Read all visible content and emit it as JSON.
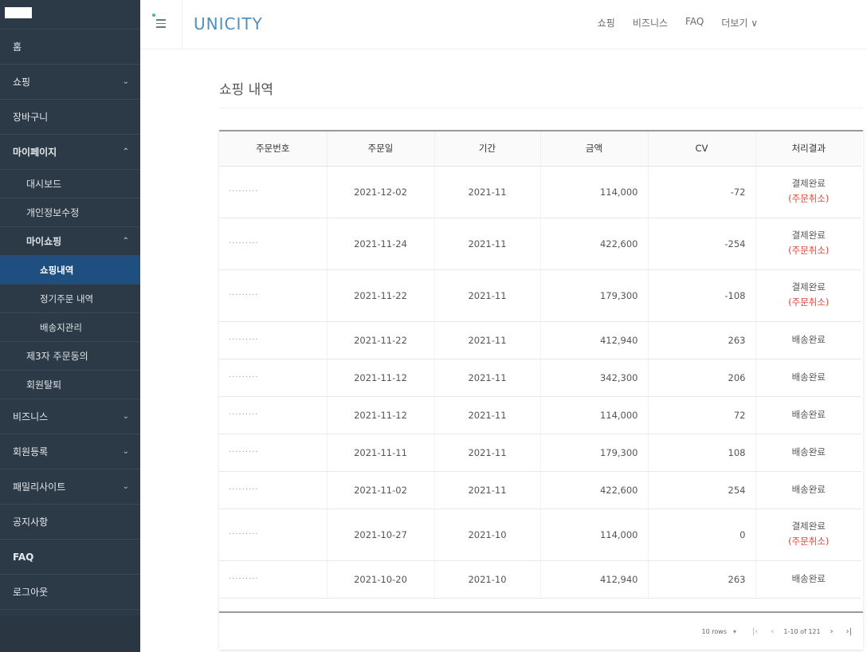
{
  "sidebar": {
    "items": [
      {
        "label": "홈"
      },
      {
        "label": "쇼핑"
      },
      {
        "label": "장바구니"
      },
      {
        "label": "마이페이지"
      },
      {
        "label": "대시보드"
      },
      {
        "label": "개인정보수정"
      },
      {
        "label": "마이쇼핑"
      },
      {
        "label": "쇼핑내역"
      },
      {
        "label": "정기주문 내역"
      },
      {
        "label": "배송지관리"
      },
      {
        "label": "제3자 주문동의"
      },
      {
        "label": "회원탈퇴"
      },
      {
        "label": "비즈니스"
      },
      {
        "label": "회원등록"
      },
      {
        "label": "패밀리사이트"
      },
      {
        "label": "공지사항"
      },
      {
        "label": "FAQ"
      },
      {
        "label": "로그아웃"
      }
    ]
  },
  "header": {
    "brand": "UNICITY",
    "nav": [
      "쇼핑",
      "비즈니스",
      "FAQ",
      "더보기 ∨"
    ]
  },
  "main": {
    "title": "쇼핑 내역",
    "columns": [
      "주문번호",
      "주문일",
      "기간",
      "금액",
      "CV",
      "처리결과"
    ],
    "rows": [
      {
        "order": "·········",
        "date": "2021-12-02",
        "period": "2021-11",
        "amount": "114,000",
        "cv": "-72",
        "status": "결제완료",
        "note": "(주문취소)"
      },
      {
        "order": "·········",
        "date": "2021-11-24",
        "period": "2021-11",
        "amount": "422,600",
        "cv": "-254",
        "status": "결제완료",
        "note": "(주문취소)"
      },
      {
        "order": "·········",
        "date": "2021-11-22",
        "period": "2021-11",
        "amount": "179,300",
        "cv": "-108",
        "status": "결제완료",
        "note": "(주문취소)"
      },
      {
        "order": "·········",
        "date": "2021-11-22",
        "period": "2021-11",
        "amount": "412,940",
        "cv": "263",
        "status": "배송완료",
        "note": ""
      },
      {
        "order": "·········",
        "date": "2021-11-12",
        "period": "2021-11",
        "amount": "342,300",
        "cv": "206",
        "status": "배송완료",
        "note": ""
      },
      {
        "order": "·········",
        "date": "2021-11-12",
        "period": "2021-11",
        "amount": "114,000",
        "cv": "72",
        "status": "배송완료",
        "note": ""
      },
      {
        "order": "·········",
        "date": "2021-11-11",
        "period": "2021-11",
        "amount": "179,300",
        "cv": "108",
        "status": "배송완료",
        "note": ""
      },
      {
        "order": "·········",
        "date": "2021-11-02",
        "period": "2021-11",
        "amount": "422,600",
        "cv": "254",
        "status": "배송완료",
        "note": ""
      },
      {
        "order": "·········",
        "date": "2021-10-27",
        "period": "2021-10",
        "amount": "114,000",
        "cv": "0",
        "status": "결제완료",
        "note": "(주문취소)"
      },
      {
        "order": "·········",
        "date": "2021-10-20",
        "period": "2021-10",
        "amount": "412,940",
        "cv": "263",
        "status": "배송완료",
        "note": ""
      }
    ],
    "pagination": {
      "rows_label": "10 rows",
      "range_label": "1-10 of 121"
    }
  },
  "colors": {
    "sidebar_bg": "#2c3a47",
    "active_bg": "#1f4e80",
    "brand": "#4e8fbd",
    "cancel_red": "#e0473a"
  }
}
